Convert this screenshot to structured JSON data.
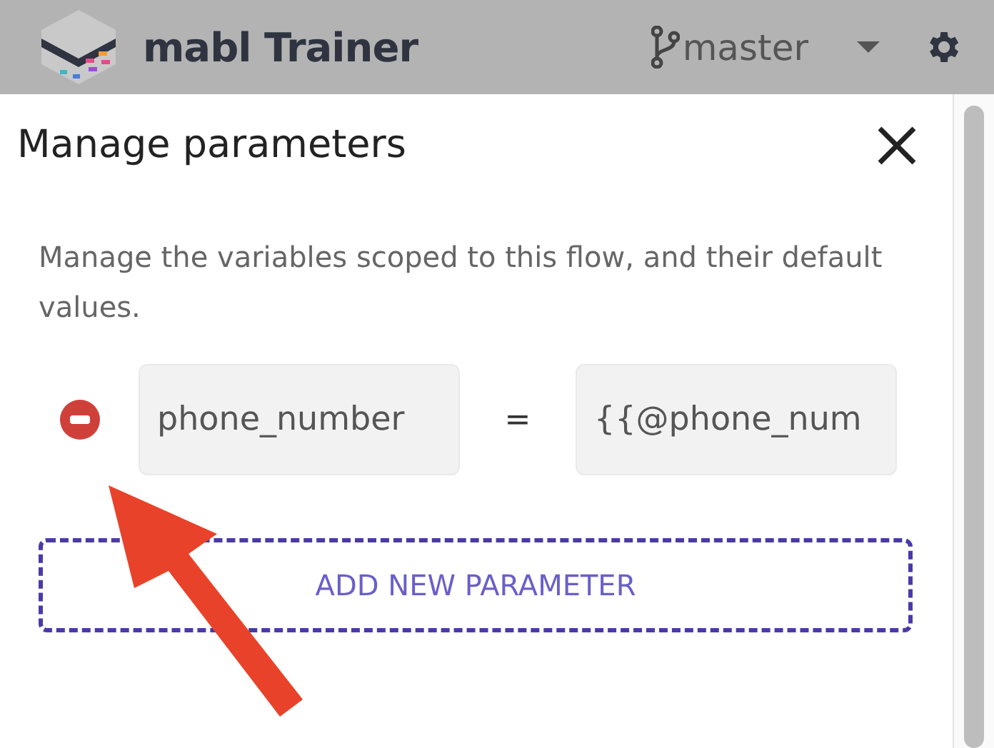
{
  "header": {
    "app_name": "mabl Trainer",
    "branch": "master"
  },
  "dialog": {
    "title": "Manage parameters",
    "description": "Manage the variables scoped to this flow, and their default values.",
    "parameters": [
      {
        "name": "phone_number",
        "separator": "=",
        "value": "{{@phone_num"
      }
    ],
    "add_button": "ADD NEW PARAMETER"
  }
}
